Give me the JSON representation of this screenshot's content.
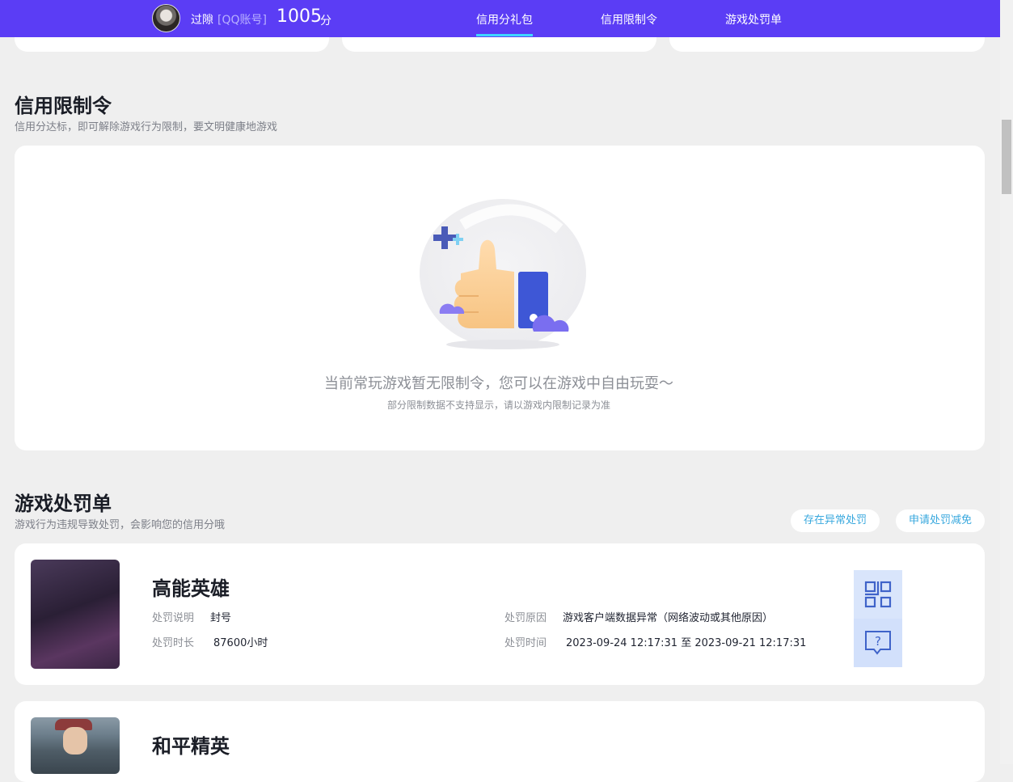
{
  "header": {
    "username": "过隙",
    "account_type": "[QQ账号]",
    "score": "1005",
    "score_unit": "分",
    "tabs": [
      {
        "label": "信用分礼包",
        "active": true
      },
      {
        "label": "信用限制令",
        "active": false
      },
      {
        "label": "游戏处罚单",
        "active": false
      }
    ]
  },
  "restriction": {
    "title": "信用限制令",
    "subtitle": "信用分达标，即可解除游戏行为限制，要文明健康地游戏",
    "empty_main": "当前常玩游戏暂无限制令，您可以在游戏中自由玩耍～",
    "empty_sub": "部分限制数据不支持显示，请以游戏内限制记录为准"
  },
  "penalty": {
    "title": "游戏处罚单",
    "subtitle": "游戏行为违规导致处罚，会影响您的信用分哦",
    "buttons": {
      "abnormal": "存在异常处罚",
      "reduce": "申请处罚减免"
    },
    "labels": {
      "desc": "处罚说明",
      "duration": "处罚时长",
      "reason": "处罚原因",
      "time": "处罚时间"
    },
    "items": [
      {
        "game": "高能英雄",
        "desc": "封号",
        "duration": "87600小时",
        "reason": "游戏客户端数据异常（网络波动或其他原因）",
        "time": "2023-09-24 12:17:31 至 2023-09-21 12:17:31"
      },
      {
        "game": "和平精英"
      }
    ]
  },
  "colors": {
    "brand": "#5b3df5",
    "accent": "#3fd6ff",
    "link": "#38a8de"
  },
  "icons": [
    "avatar",
    "qr-code-icon",
    "help-chat-icon",
    "thumbs-up-illustration"
  ]
}
